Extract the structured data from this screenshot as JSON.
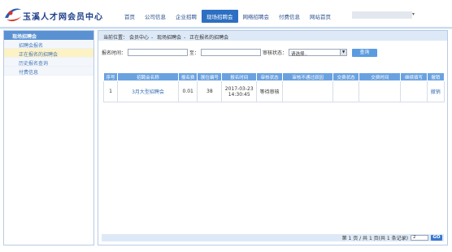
{
  "header": {
    "site_title": "玉溪人才网会员中心",
    "nav": [
      "首页",
      "公司信息",
      "企业招聘",
      "现场招聘会",
      "网络招聘会",
      "付费信息",
      "网站首页"
    ],
    "active_nav": 3,
    "user_caret": "▾"
  },
  "sidebar": {
    "title": "现场招聘会",
    "items": [
      "招聘会报名",
      "正在报名的招聘会",
      "历史报名查询",
      "付费信息"
    ],
    "active_item": 1
  },
  "breadcrumb": {
    "label": "当前位置：",
    "parts": [
      "会员中心",
      "现场招聘会",
      "正在报名的招聘会"
    ],
    "separator": "-"
  },
  "filter": {
    "time_label": "报名时间：",
    "to_label": "至：",
    "status_label": "审核状态：",
    "status_value": "请选择..",
    "query_button": "查询"
  },
  "table": {
    "headers": [
      "序号",
      "招聘会名称",
      "报名费",
      "展位编号",
      "报名时间",
      "审核状态",
      "审核不通过原因",
      "交费状态",
      "交费时间",
      "继续填写",
      "撤销"
    ],
    "rows": [
      {
        "index": "1",
        "name": "3月大型招聘会",
        "fee": "0.01",
        "booth": "38",
        "time_date": "2017-03-23",
        "time_clock": "14:30:45",
        "audit": "等待审核",
        "reason": "",
        "pay_status": "",
        "pay_time": "",
        "continue": "",
        "cancel": "撤销"
      }
    ]
  },
  "pager": {
    "summary": "第 1 页 / 共 1 页(共 1 条记录)",
    "page_value": "2",
    "go_button": "GO"
  },
  "colors": {
    "nav_active": "#2d6fc2",
    "sidebar_head": "#5a91d3",
    "table_head": "#6aa2e0",
    "link": "#3a6fb5"
  }
}
